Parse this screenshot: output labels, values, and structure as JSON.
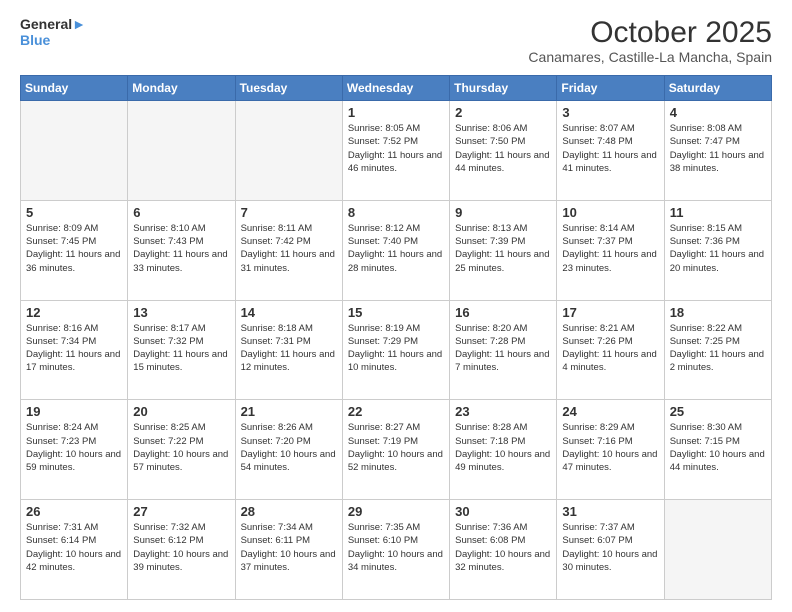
{
  "header": {
    "logo_line1": "General",
    "logo_line2": "Blue",
    "title": "October 2025",
    "subtitle": "Canamares, Castille-La Mancha, Spain"
  },
  "weekdays": [
    "Sunday",
    "Monday",
    "Tuesday",
    "Wednesday",
    "Thursday",
    "Friday",
    "Saturday"
  ],
  "weeks": [
    [
      {
        "day": "",
        "empty": true
      },
      {
        "day": "",
        "empty": true
      },
      {
        "day": "",
        "empty": true
      },
      {
        "day": "1",
        "sunrise": "8:05 AM",
        "sunset": "7:52 PM",
        "daylight": "11 hours and 46 minutes."
      },
      {
        "day": "2",
        "sunrise": "8:06 AM",
        "sunset": "7:50 PM",
        "daylight": "11 hours and 44 minutes."
      },
      {
        "day": "3",
        "sunrise": "8:07 AM",
        "sunset": "7:48 PM",
        "daylight": "11 hours and 41 minutes."
      },
      {
        "day": "4",
        "sunrise": "8:08 AM",
        "sunset": "7:47 PM",
        "daylight": "11 hours and 38 minutes."
      }
    ],
    [
      {
        "day": "5",
        "sunrise": "8:09 AM",
        "sunset": "7:45 PM",
        "daylight": "11 hours and 36 minutes."
      },
      {
        "day": "6",
        "sunrise": "8:10 AM",
        "sunset": "7:43 PM",
        "daylight": "11 hours and 33 minutes."
      },
      {
        "day": "7",
        "sunrise": "8:11 AM",
        "sunset": "7:42 PM",
        "daylight": "11 hours and 31 minutes."
      },
      {
        "day": "8",
        "sunrise": "8:12 AM",
        "sunset": "7:40 PM",
        "daylight": "11 hours and 28 minutes."
      },
      {
        "day": "9",
        "sunrise": "8:13 AM",
        "sunset": "7:39 PM",
        "daylight": "11 hours and 25 minutes."
      },
      {
        "day": "10",
        "sunrise": "8:14 AM",
        "sunset": "7:37 PM",
        "daylight": "11 hours and 23 minutes."
      },
      {
        "day": "11",
        "sunrise": "8:15 AM",
        "sunset": "7:36 PM",
        "daylight": "11 hours and 20 minutes."
      }
    ],
    [
      {
        "day": "12",
        "sunrise": "8:16 AM",
        "sunset": "7:34 PM",
        "daylight": "11 hours and 17 minutes."
      },
      {
        "day": "13",
        "sunrise": "8:17 AM",
        "sunset": "7:32 PM",
        "daylight": "11 hours and 15 minutes."
      },
      {
        "day": "14",
        "sunrise": "8:18 AM",
        "sunset": "7:31 PM",
        "daylight": "11 hours and 12 minutes."
      },
      {
        "day": "15",
        "sunrise": "8:19 AM",
        "sunset": "7:29 PM",
        "daylight": "11 hours and 10 minutes."
      },
      {
        "day": "16",
        "sunrise": "8:20 AM",
        "sunset": "7:28 PM",
        "daylight": "11 hours and 7 minutes."
      },
      {
        "day": "17",
        "sunrise": "8:21 AM",
        "sunset": "7:26 PM",
        "daylight": "11 hours and 4 minutes."
      },
      {
        "day": "18",
        "sunrise": "8:22 AM",
        "sunset": "7:25 PM",
        "daylight": "11 hours and 2 minutes."
      }
    ],
    [
      {
        "day": "19",
        "sunrise": "8:24 AM",
        "sunset": "7:23 PM",
        "daylight": "10 hours and 59 minutes."
      },
      {
        "day": "20",
        "sunrise": "8:25 AM",
        "sunset": "7:22 PM",
        "daylight": "10 hours and 57 minutes."
      },
      {
        "day": "21",
        "sunrise": "8:26 AM",
        "sunset": "7:20 PM",
        "daylight": "10 hours and 54 minutes."
      },
      {
        "day": "22",
        "sunrise": "8:27 AM",
        "sunset": "7:19 PM",
        "daylight": "10 hours and 52 minutes."
      },
      {
        "day": "23",
        "sunrise": "8:28 AM",
        "sunset": "7:18 PM",
        "daylight": "10 hours and 49 minutes."
      },
      {
        "day": "24",
        "sunrise": "8:29 AM",
        "sunset": "7:16 PM",
        "daylight": "10 hours and 47 minutes."
      },
      {
        "day": "25",
        "sunrise": "8:30 AM",
        "sunset": "7:15 PM",
        "daylight": "10 hours and 44 minutes."
      }
    ],
    [
      {
        "day": "26",
        "sunrise": "7:31 AM",
        "sunset": "6:14 PM",
        "daylight": "10 hours and 42 minutes."
      },
      {
        "day": "27",
        "sunrise": "7:32 AM",
        "sunset": "6:12 PM",
        "daylight": "10 hours and 39 minutes."
      },
      {
        "day": "28",
        "sunrise": "7:34 AM",
        "sunset": "6:11 PM",
        "daylight": "10 hours and 37 minutes."
      },
      {
        "day": "29",
        "sunrise": "7:35 AM",
        "sunset": "6:10 PM",
        "daylight": "10 hours and 34 minutes."
      },
      {
        "day": "30",
        "sunrise": "7:36 AM",
        "sunset": "6:08 PM",
        "daylight": "10 hours and 32 minutes."
      },
      {
        "day": "31",
        "sunrise": "7:37 AM",
        "sunset": "6:07 PM",
        "daylight": "10 hours and 30 minutes."
      },
      {
        "day": "",
        "empty": true
      }
    ]
  ],
  "labels": {
    "sunrise": "Sunrise:",
    "sunset": "Sunset:",
    "daylight": "Daylight:"
  }
}
